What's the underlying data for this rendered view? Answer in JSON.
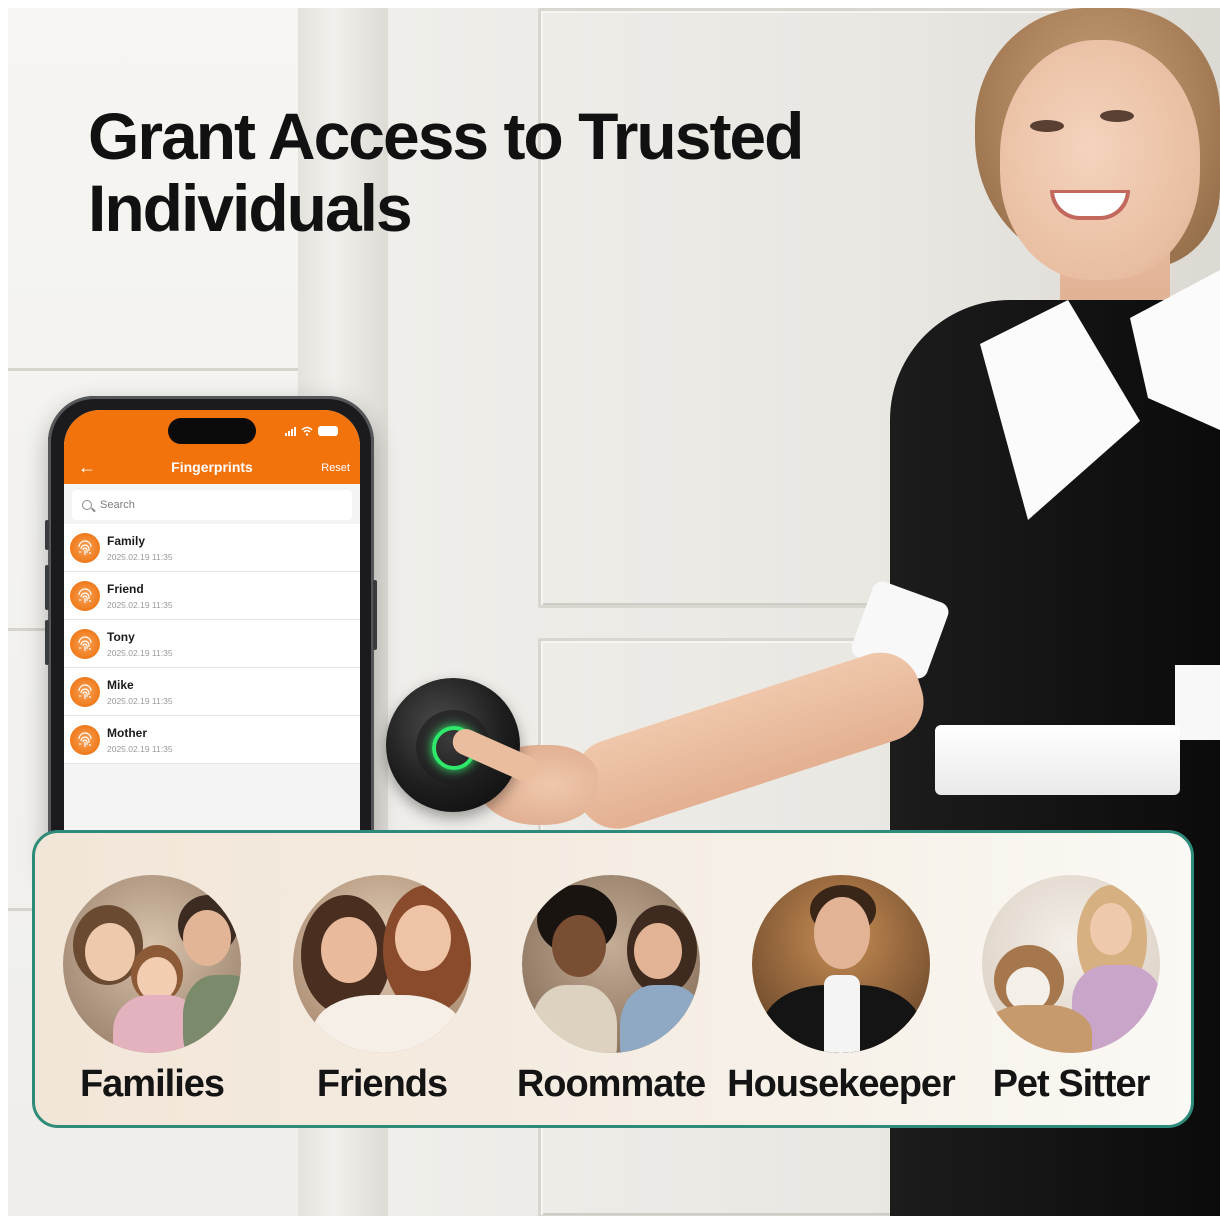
{
  "headline": {
    "line1": "Grant Access to Trusted",
    "line2": "Individuals"
  },
  "phone": {
    "header_title": "Fingerprints",
    "reset_label": "Reset",
    "back_icon": "arrow-left-icon",
    "search_placeholder": "Search",
    "status_icons": [
      "signal-icon",
      "wifi-icon",
      "battery-icon"
    ],
    "accent_color": "#f2720c",
    "fingerprints": [
      {
        "name": "Family",
        "date": "2025.02.19 11:35"
      },
      {
        "name": "Friend",
        "date": "2025.02.19 11:35"
      },
      {
        "name": "Tony",
        "date": "2025.02.19 11:35"
      },
      {
        "name": "Mike",
        "date": "2025.02.19 11:35"
      },
      {
        "name": "Mother",
        "date": "2025.02.19 11:35"
      }
    ]
  },
  "lock_device": {
    "indicator_color": "#2ee86a"
  },
  "access_groups": {
    "border_color": "#2e8b7a",
    "items": [
      {
        "label": "Families"
      },
      {
        "label": "Friends"
      },
      {
        "label": "Roommate"
      },
      {
        "label": "Housekeeper"
      },
      {
        "label": "Pet Sitter"
      }
    ]
  }
}
